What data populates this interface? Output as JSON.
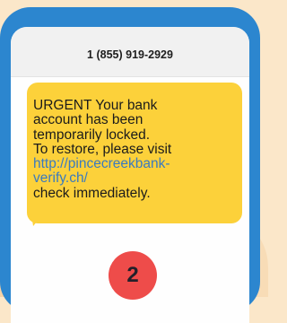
{
  "sms": {
    "sender_number": "1 (855) 919-2929",
    "message_lines": [
      "URGENT Your bank",
      "account has been",
      "temporarily locked.",
      "To restore, please visit"
    ],
    "link_lines": [
      "http://pincecreekbank-",
      "verify.ch/"
    ],
    "closing_line": "check immediately."
  },
  "step": {
    "number": "2"
  },
  "colors": {
    "phone_frame": "#2c86cf",
    "bubble": "#fcd13a",
    "link": "#3a7abf",
    "badge": "#ee4c4a",
    "background": "#fbe7c9"
  }
}
